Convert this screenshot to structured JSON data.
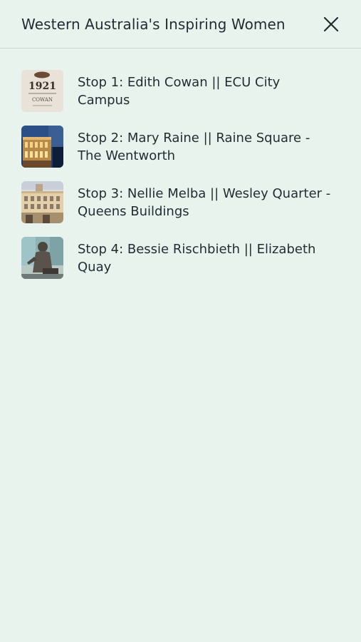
{
  "header": {
    "title": "Western Australia's Inspiring Women",
    "close_icon": "close-icon"
  },
  "stops": [
    {
      "label": "Stop 1: Edith Cowan || ECU City Campus",
      "thumb_subject": "ECU 1921 plaque"
    },
    {
      "label": "Stop 2: Mary Raine || Raine Square - The Wentworth",
      "thumb_subject": "Wentworth building at night"
    },
    {
      "label": "Stop 3: Nellie Melba || Wesley Quarter - Queens Buildings",
      "thumb_subject": "Queens Buildings facade"
    },
    {
      "label": "Stop 4: Bessie Rischbieth || Elizabeth Quay",
      "thumb_subject": "Bessie Rischbieth statue"
    }
  ],
  "thumb_texts": {
    "plaque_year": "1921",
    "plaque_name": "COWAN"
  },
  "colors": {
    "background": "#e8f3ee",
    "text": "#1f2d33",
    "divider": "#cfdad5"
  }
}
